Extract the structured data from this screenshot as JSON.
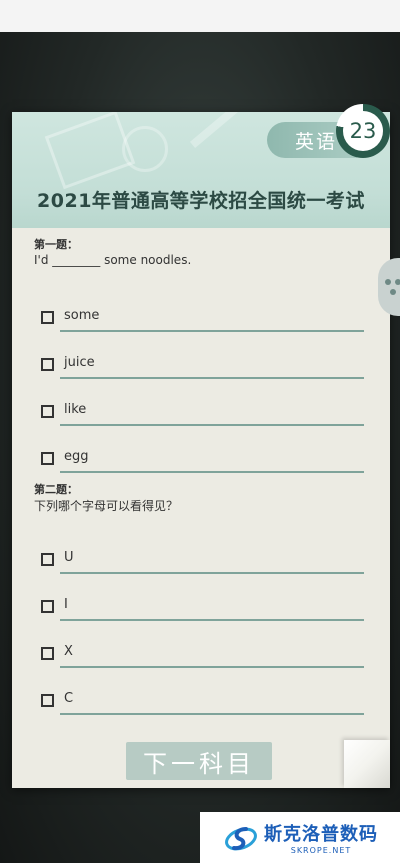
{
  "subject": "英语",
  "timer": {
    "value": "23",
    "remaining_fraction": 0.78
  },
  "title": "2021年普通高等学校招全国统一考试",
  "questions": [
    {
      "heading": "第一题：",
      "text": "I'd ________ some noodles.",
      "options": [
        "some",
        "juice",
        "like",
        "egg"
      ]
    },
    {
      "heading": "第二题：",
      "text": "下列哪个字母可以看得见？",
      "options": [
        "U",
        "I",
        "X",
        "C"
      ]
    }
  ],
  "next_button": "下一科目",
  "watermark": {
    "name": "斯克洛普数码",
    "site": "SKROPE.NET"
  },
  "colors": {
    "accent": "#2a5b4c",
    "header": "#c3ded6",
    "line": "#7fa39a",
    "watermark": "#1d5fb8"
  }
}
